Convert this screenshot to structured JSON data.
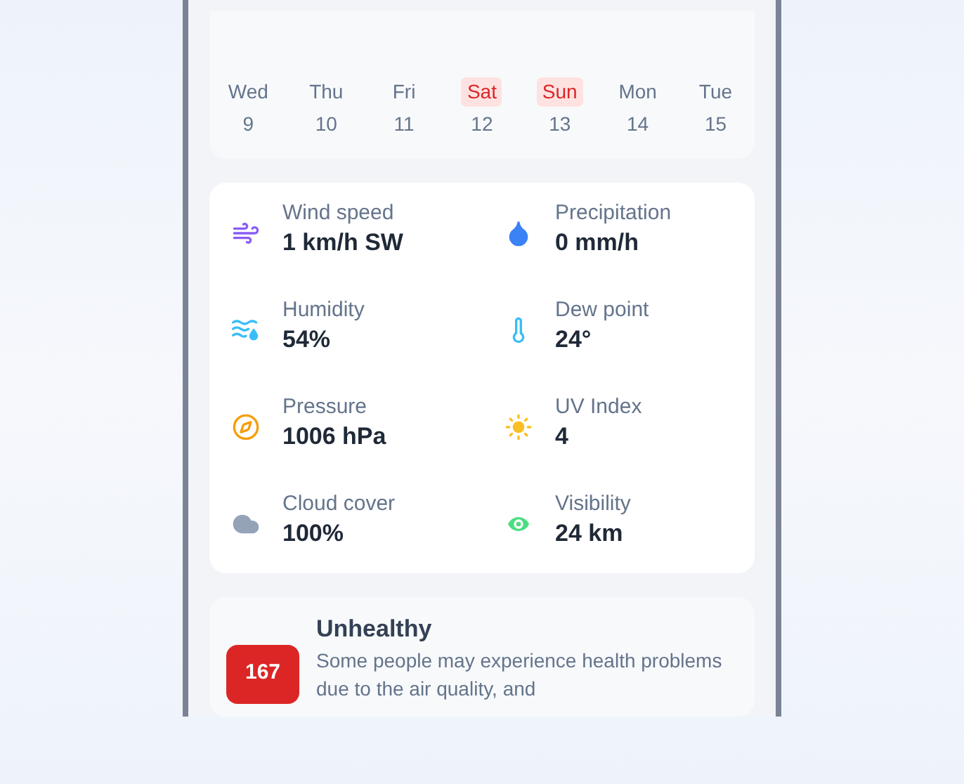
{
  "forecast_days": [
    {
      "day": "Wed",
      "date": "9",
      "weekend": false
    },
    {
      "day": "Thu",
      "date": "10",
      "weekend": false
    },
    {
      "day": "Fri",
      "date": "11",
      "weekend": false
    },
    {
      "day": "Sat",
      "date": "12",
      "weekend": true
    },
    {
      "day": "Sun",
      "date": "13",
      "weekend": true
    },
    {
      "day": "Mon",
      "date": "14",
      "weekend": false
    },
    {
      "day": "Tue",
      "date": "15",
      "weekend": false
    }
  ],
  "metrics": [
    {
      "label": "Wind speed",
      "value": "1 km/h SW"
    },
    {
      "label": "Precipitation",
      "value": "0 mm/h"
    },
    {
      "label": "Humidity",
      "value": "54%"
    },
    {
      "label": "Dew point",
      "value": "24°"
    },
    {
      "label": "Pressure",
      "value": "1006 hPa"
    },
    {
      "label": "UV Index",
      "value": "4"
    },
    {
      "label": "Cloud cover",
      "value": "100%"
    },
    {
      "label": "Visibility",
      "value": "24 km"
    }
  ],
  "air_quality": {
    "index": "167",
    "title": "Unhealthy",
    "description": "Some people may experience health problems due to the air quality, and"
  }
}
